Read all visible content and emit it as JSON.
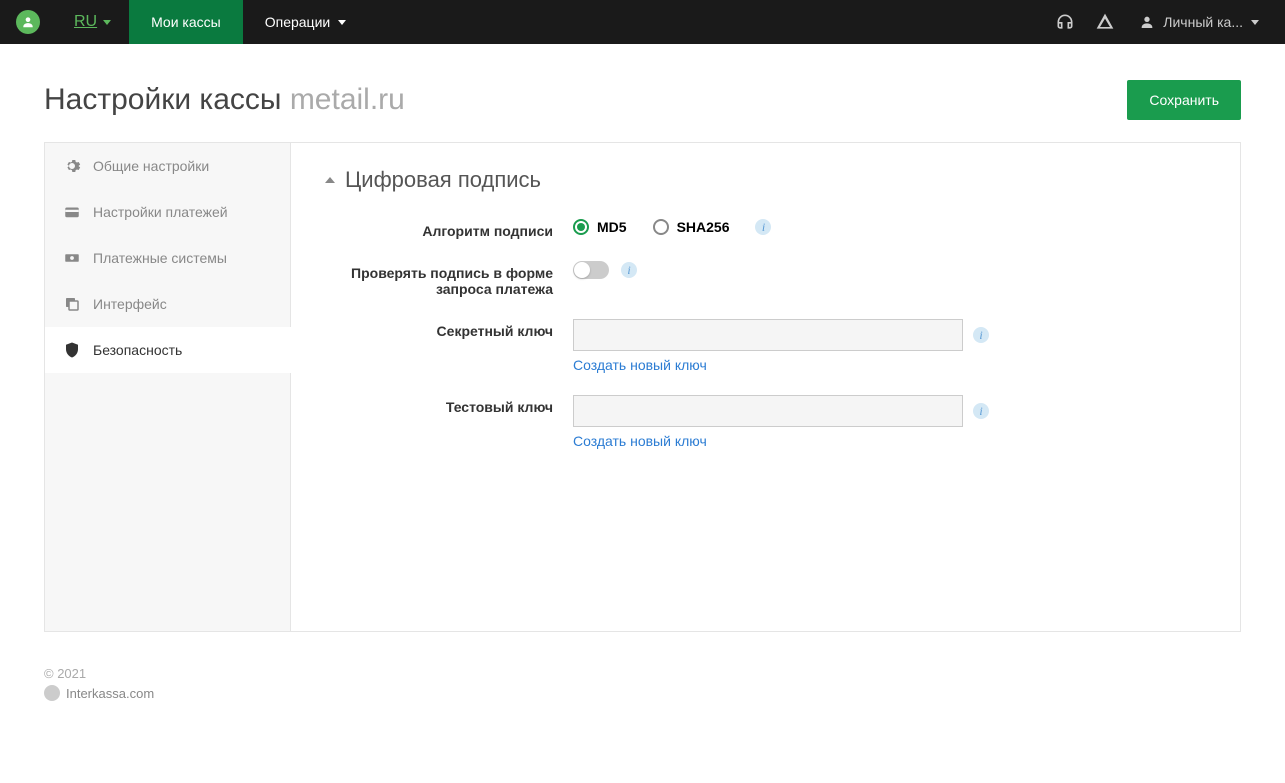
{
  "topbar": {
    "lang": "RU",
    "nav": [
      {
        "label": "Мои кассы",
        "active": true
      },
      {
        "label": "Операции",
        "dropdown": true
      }
    ],
    "account_label": "Личный ка..."
  },
  "page": {
    "title_main": "Настройки кассы",
    "title_sub": "metail.ru",
    "save_btn": "Сохранить"
  },
  "sidebar": {
    "items": [
      {
        "label": "Общие настройки",
        "icon": "gear"
      },
      {
        "label": "Настройки платежей",
        "icon": "wallet"
      },
      {
        "label": "Платежные системы",
        "icon": "cash"
      },
      {
        "label": "Интерфейс",
        "icon": "windows"
      },
      {
        "label": "Безопасность",
        "icon": "shield",
        "active": true
      }
    ]
  },
  "section": {
    "title": "Цифровая подпись",
    "fields": {
      "algo_label": "Алгоритм подписи",
      "algo_opt1": "MD5",
      "algo_opt2": "SHA256",
      "verify_label": "Проверять подпись в форме запроса платежа",
      "secret_label": "Секретный ключ",
      "test_label": "Тестовый ключ",
      "create_key_link": "Создать новый ключ"
    }
  },
  "footer": {
    "copyright": "© 2021",
    "link": "Interkassa.com"
  }
}
